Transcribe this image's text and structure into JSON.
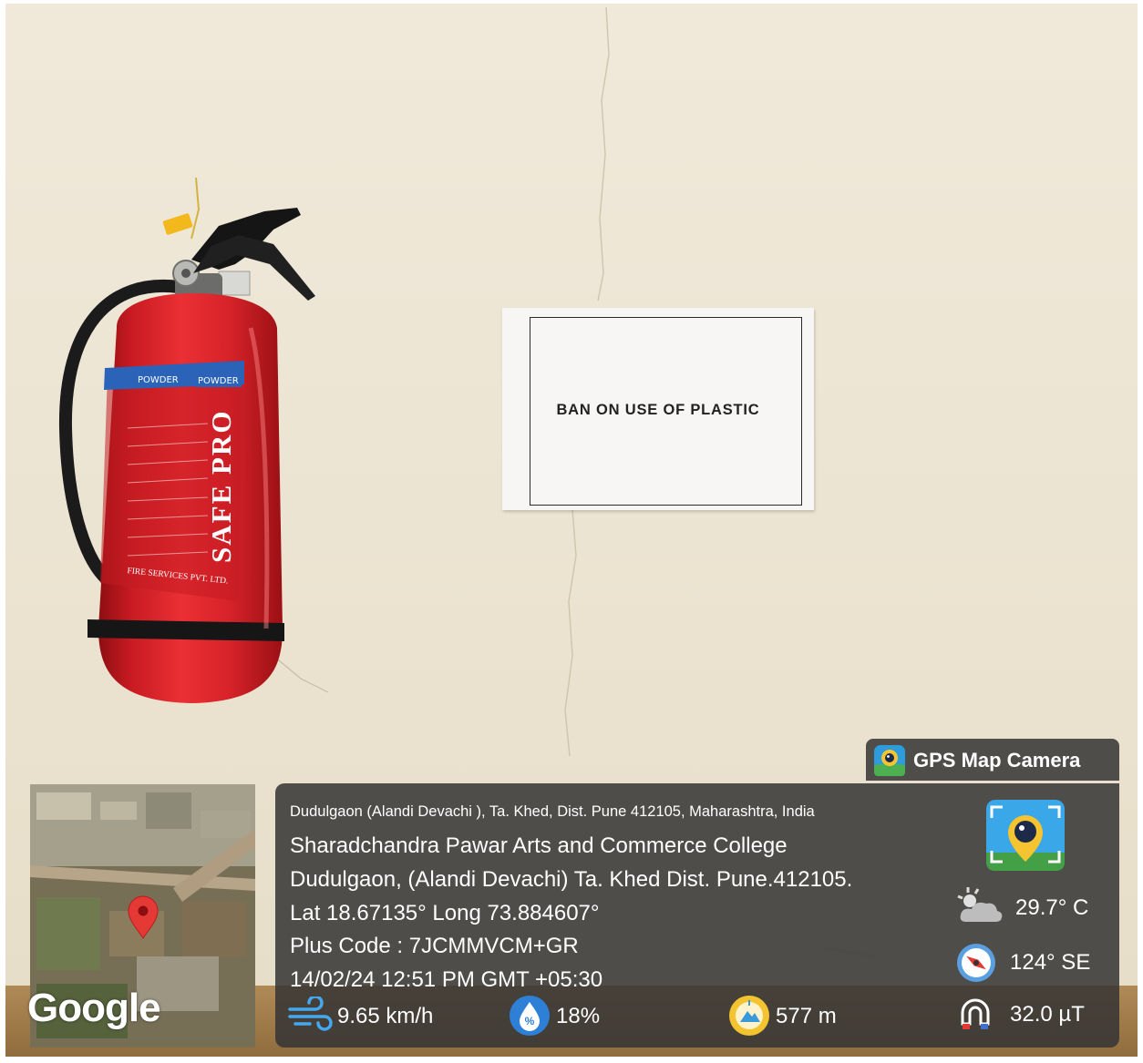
{
  "poster": {
    "title": "BAN ON USE OF PLASTIC"
  },
  "extinguisher": {
    "brand": "SAFE PRO",
    "band_labels": [
      "POWDER",
      "POWDER"
    ],
    "company": "FIRE SERVICES PVT. LTD."
  },
  "gps_app": {
    "name": "GPS Map Camera",
    "address": "Dudulgaon (Alandi Devachi ), Ta. Khed, Dist. Pune 412105, Maharashtra, India",
    "place_line1": "Sharadchandra Pawar Arts and Commerce College",
    "place_line2": "Dudulgaon, (Alandi Devachi) Ta. Khed Dist. Pune.412105.",
    "lat_long": "Lat 18.67135° Long 73.884607°",
    "plus_code": "Plus Code : 7JCMMVCM+GR",
    "datetime": "14/02/24 12:51 PM GMT +05:30",
    "wind": "9.65 km/h",
    "humidity": "18%",
    "altitude": "577 m",
    "temperature": "29.7° C",
    "heading": "124° SE",
    "magnetic": "32.0 µT",
    "map_brand": "Google"
  },
  "icons": {
    "app_icon": "camera-pin-icon",
    "wind": "wind-icon",
    "humidity": "humidity-drop-icon",
    "altitude": "altitude-icon",
    "weather": "partly-cloudy-icon",
    "compass": "compass-icon",
    "magnet": "magnet-icon",
    "map_pin": "map-pin-icon"
  },
  "colors": {
    "wall": "#ece4d2",
    "extinguisher_red": "#d8232a",
    "overlay": "#343434",
    "pin_red": "#e53935"
  }
}
